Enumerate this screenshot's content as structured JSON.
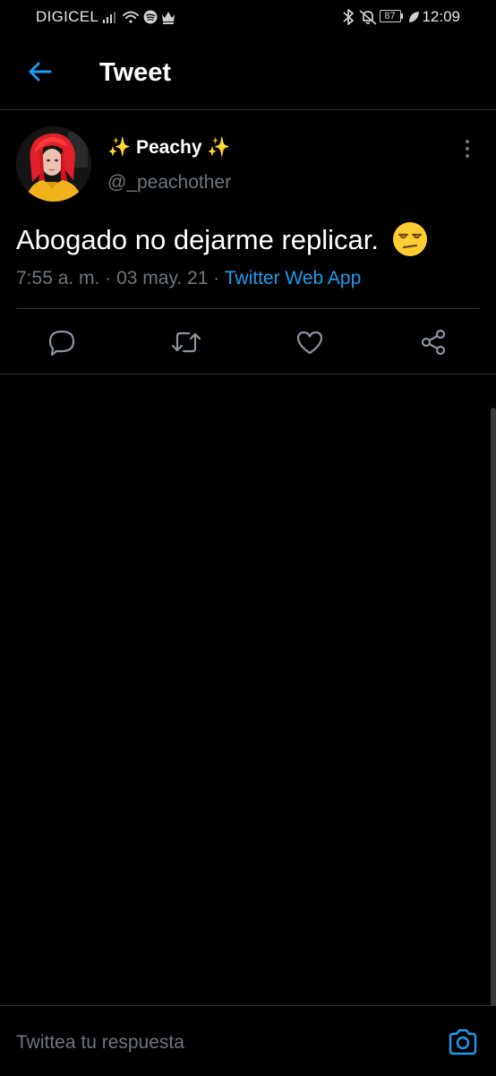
{
  "status_bar": {
    "carrier": "DIGICEL",
    "battery_level": "87",
    "time": "12:09"
  },
  "header": {
    "title": "Tweet"
  },
  "tweet": {
    "author_name": "Peachy",
    "author_sparkle": "✨",
    "author_handle": "@_peachother",
    "text": "Abogado no dejarme replicar.",
    "time": "7:55 a. m.",
    "separator": "·",
    "date": "03 may. 21",
    "source": "Twitter Web App"
  },
  "reply": {
    "placeholder": "Twittea tu respuesta"
  },
  "colors": {
    "accent": "#1d9bf0",
    "background": "#000000",
    "secondary_text": "#6e767d",
    "divider": "#2f3336"
  },
  "icons": {
    "back": "arrow-left-icon",
    "reply": "speech-bubble-icon",
    "retweet": "retweet-icon",
    "like": "heart-icon",
    "share": "share-icon",
    "camera": "camera-icon",
    "more": "vertical-dots-icon"
  }
}
